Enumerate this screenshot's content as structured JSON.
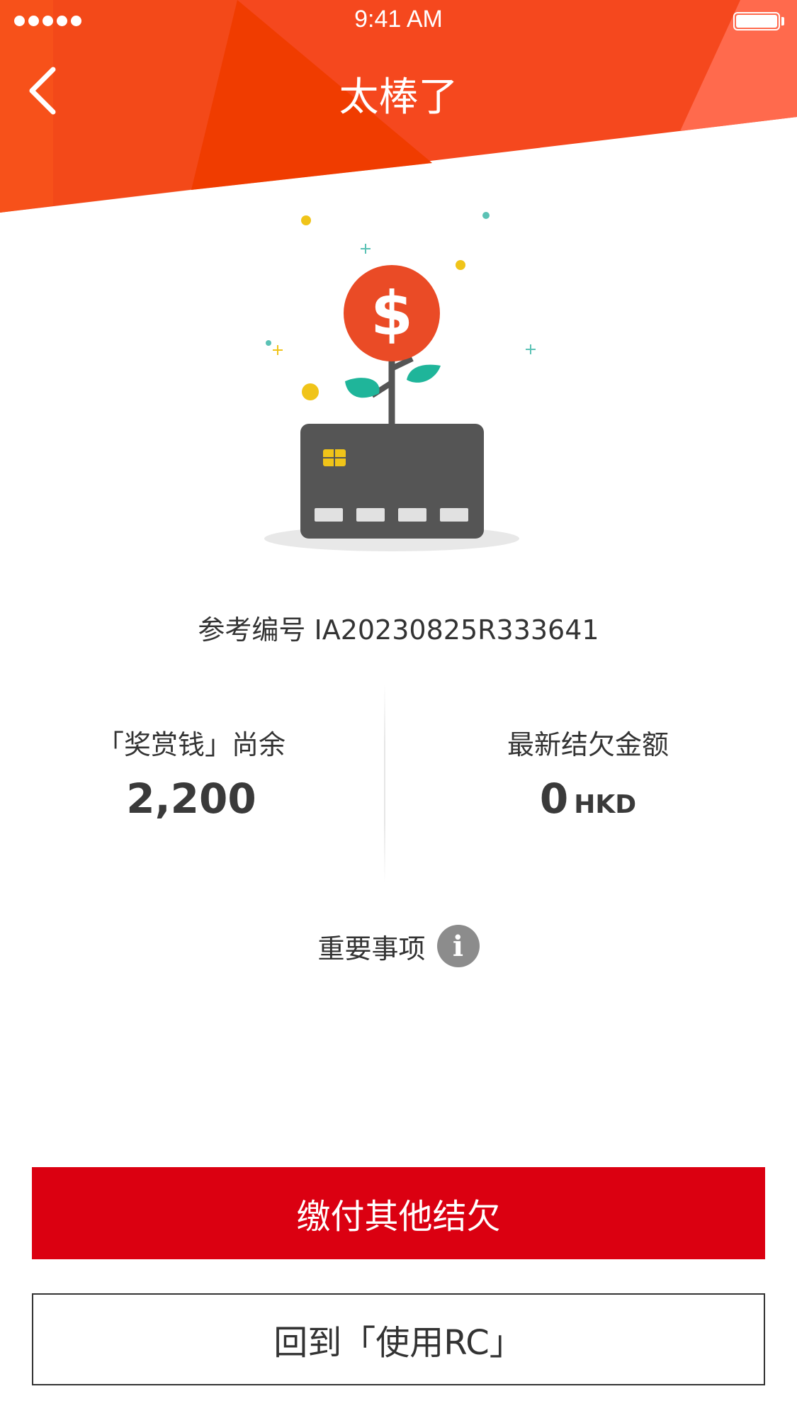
{
  "status_bar": {
    "time": "9:41 AM"
  },
  "header": {
    "title": "太棒了",
    "back_icon": "chevron-left-icon",
    "colors": {
      "primary": "#f5481e",
      "dark": "#f03c00",
      "light": "#ff6a4d"
    }
  },
  "hero": {
    "icon": "money-plant-card-icon",
    "currency_symbol": "$"
  },
  "reference": {
    "label": "参考编号",
    "number": "IA20230825R333641"
  },
  "stats": {
    "reward_label": "「奖赏钱」尚余",
    "reward_value": "2,200",
    "balance_label": "最新结欠金额",
    "balance_value": "0",
    "balance_unit": "HKD"
  },
  "notice": {
    "label": "重要事项",
    "icon": "info-icon",
    "icon_glyph": "i"
  },
  "actions": {
    "pay_other": "缴付其他结欠",
    "back_to_rc": "回到「使用RC」",
    "primary_color": "#db0011"
  }
}
